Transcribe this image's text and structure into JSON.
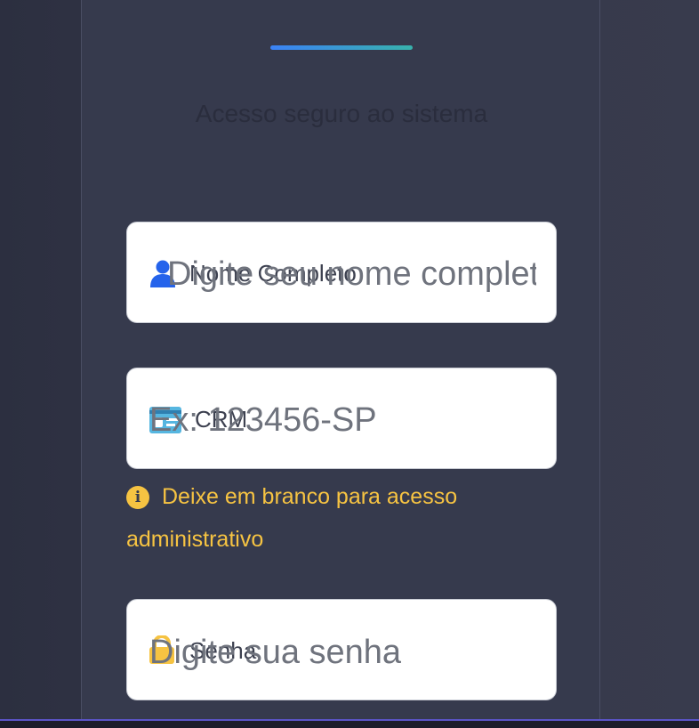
{
  "header": {
    "subtitle": "Acesso seguro ao sistema"
  },
  "form": {
    "nome": {
      "label": "Nome Completo",
      "placeholder": "Digite seu nome complet",
      "icon": "user-icon"
    },
    "crm": {
      "label": "CRM",
      "placeholder": "Ex: 123456-SP",
      "icon": "id-card-icon",
      "hint": "Deixe em branco para acesso administrativo"
    },
    "senha": {
      "label": "Senha",
      "placeholder": "Digite sua senha",
      "icon": "lock-icon"
    }
  },
  "colors": {
    "accent_start": "#3b82f6",
    "accent_end": "#38b2ac",
    "hint": "#f6c342",
    "user_icon": "#2563eb",
    "id_icon": "#56b6e0",
    "lock_icon": "#f6c342"
  }
}
